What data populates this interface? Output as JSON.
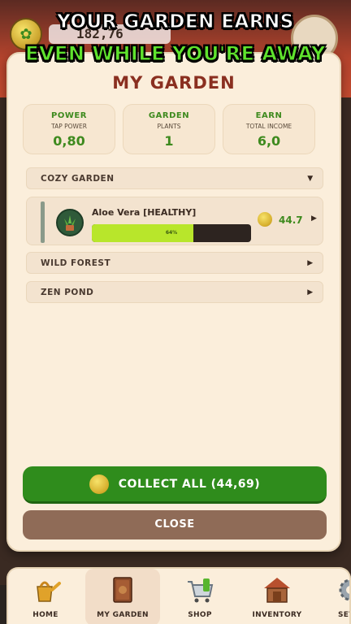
{
  "hud": {
    "balance": "182,76"
  },
  "promo": {
    "line1": "YOUR GARDEN EARNS",
    "line2": "EVEN WHILE YOU'RE AWAY"
  },
  "modal": {
    "title": "MY GARDEN",
    "stats": [
      {
        "title": "POWER",
        "sub": "TAP POWER",
        "value": "0,80"
      },
      {
        "title": "GARDEN",
        "sub": "PLANTS",
        "value": "1"
      },
      {
        "title": "EARN",
        "sub": "TOTAL INCOME",
        "value": "6,0"
      }
    ],
    "gardens": [
      {
        "name": "COZY GARDEN",
        "expanded": true
      },
      {
        "name": "WILD FOREST",
        "expanded": false
      },
      {
        "name": "ZEN POND",
        "expanded": false
      }
    ],
    "plant": {
      "name": "Aloe Vera [HEALTHY]",
      "progress_label": "64%",
      "progress": 0.64,
      "value": "44.7"
    },
    "collect_label": "COLLECT ALL (44,69)",
    "close_label": "CLOSE"
  },
  "nav": {
    "items": [
      {
        "label": "HOME",
        "icon": "watering-can-icon"
      },
      {
        "label": "MY GARDEN",
        "icon": "book-icon"
      },
      {
        "label": "SHOP",
        "icon": "cart-icon"
      },
      {
        "label": "INVENTORY",
        "icon": "shed-icon"
      },
      {
        "label": "SETTI",
        "icon": "gear-icon"
      }
    ]
  },
  "colors": {
    "green": "#2f8c1c",
    "title_red": "#8a2f20",
    "progress_fill": "#b8e62b",
    "close_brown": "#8f6b57"
  }
}
